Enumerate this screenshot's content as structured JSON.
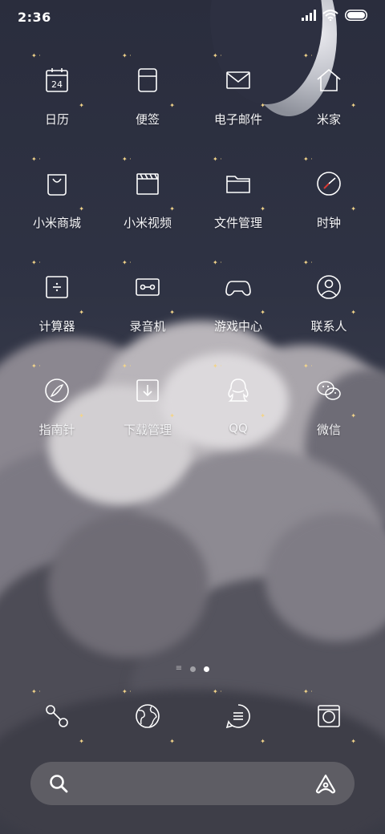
{
  "status_bar": {
    "time": "2:36",
    "icons": [
      "cellular-signal-icon",
      "wifi-icon",
      "battery-icon"
    ]
  },
  "apps": [
    {
      "label": "日历",
      "icon": "calendar-icon",
      "icon_text": "24"
    },
    {
      "label": "便签",
      "icon": "notes-icon"
    },
    {
      "label": "电子邮件",
      "icon": "email-icon"
    },
    {
      "label": "米家",
      "icon": "home-icon"
    },
    {
      "label": "小米商城",
      "icon": "shopping-bag-icon"
    },
    {
      "label": "小米视频",
      "icon": "video-clapper-icon"
    },
    {
      "label": "文件管理",
      "icon": "folder-icon"
    },
    {
      "label": "时钟",
      "icon": "clock-icon"
    },
    {
      "label": "计算器",
      "icon": "calculator-icon"
    },
    {
      "label": "录音机",
      "icon": "recorder-icon"
    },
    {
      "label": "游戏中心",
      "icon": "gamepad-icon"
    },
    {
      "label": "联系人",
      "icon": "contacts-icon"
    },
    {
      "label": "指南针",
      "icon": "compass-icon"
    },
    {
      "label": "下载管理",
      "icon": "download-icon"
    },
    {
      "label": "QQ",
      "icon": "qq-penguin-icon"
    },
    {
      "label": "微信",
      "icon": "wechat-icon"
    }
  ],
  "dock": [
    {
      "icon": "phone-icon"
    },
    {
      "icon": "browser-globe-icon"
    },
    {
      "icon": "messages-icon"
    },
    {
      "icon": "camera-icon"
    }
  ],
  "page_indicator": {
    "pages": 3,
    "active": 3
  },
  "search_bar": {
    "left_icon": "search-icon",
    "right_icon": "assistant-icon"
  },
  "colors": {
    "sparkle": "#f2d48a",
    "clock_hand": "#d83a34"
  }
}
